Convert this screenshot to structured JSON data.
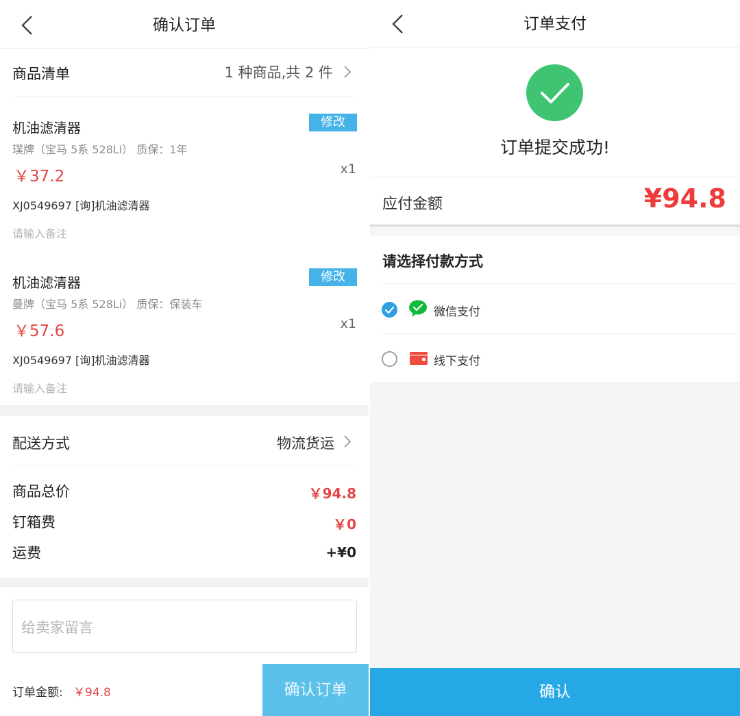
{
  "confirm_page": {
    "title": "确认订单",
    "goods_list": {
      "label": "商品清单",
      "summary": "1 种商品,共 2 件"
    },
    "items": [
      {
        "name": "机油滤清器",
        "edit_label": "修改",
        "spec": "璞牌（宝马 5系 528Li） 质保：1年",
        "price": "￥37.2",
        "qty": "x1",
        "code": "XJ0549697 [询]机油滤清器",
        "remark_placeholder": "请输入备注"
      },
      {
        "name": "机油滤清器",
        "edit_label": "修改",
        "spec": "曼牌（宝马 5系 528Li） 质保：保装车",
        "price": "￥57.6",
        "qty": "x1",
        "code": "XJ0549697 [询]机油滤清器",
        "remark_placeholder": "请输入备注"
      }
    ],
    "delivery": {
      "label": "配送方式",
      "value": "物流货运"
    },
    "totals": [
      {
        "label": "商品总价",
        "value": "￥94.8"
      },
      {
        "label": "钉箱费",
        "value": "￥0"
      },
      {
        "label": "运费",
        "value": "+¥0"
      }
    ],
    "message_placeholder": "给卖家留言",
    "footer": {
      "amount_label": "订单金额:",
      "amount_value": "￥94.8",
      "confirm_label": "确认订单"
    }
  },
  "pay_page": {
    "title": "订单支付",
    "success_text": "订单提交成功!",
    "payable_label": "应付金额",
    "payable_value": "¥94.8",
    "method_heading": "请选择付款方式",
    "methods": [
      {
        "label": "微信支付",
        "selected": true
      },
      {
        "label": "线下支付",
        "selected": false
      }
    ],
    "confirm_label": "确认"
  },
  "colors": {
    "accent_blue": "#26a8e6",
    "edit_tag_blue": "#45b3e8",
    "price_red": "#e54545",
    "success_green": "#3fc473",
    "wechat_green": "#12b83a",
    "offline_red": "#f04b3c"
  }
}
